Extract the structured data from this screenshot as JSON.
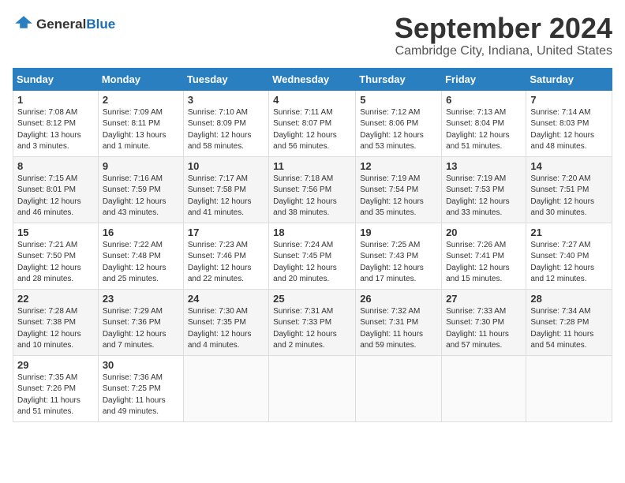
{
  "logo": {
    "general": "General",
    "blue": "Blue"
  },
  "title": "September 2024",
  "location": "Cambridge City, Indiana, United States",
  "days_of_week": [
    "Sunday",
    "Monday",
    "Tuesday",
    "Wednesday",
    "Thursday",
    "Friday",
    "Saturday"
  ],
  "weeks": [
    [
      {
        "day": "1",
        "info": "Sunrise: 7:08 AM\nSunset: 8:12 PM\nDaylight: 13 hours\nand 3 minutes."
      },
      {
        "day": "2",
        "info": "Sunrise: 7:09 AM\nSunset: 8:11 PM\nDaylight: 13 hours\nand 1 minute."
      },
      {
        "day": "3",
        "info": "Sunrise: 7:10 AM\nSunset: 8:09 PM\nDaylight: 12 hours\nand 58 minutes."
      },
      {
        "day": "4",
        "info": "Sunrise: 7:11 AM\nSunset: 8:07 PM\nDaylight: 12 hours\nand 56 minutes."
      },
      {
        "day": "5",
        "info": "Sunrise: 7:12 AM\nSunset: 8:06 PM\nDaylight: 12 hours\nand 53 minutes."
      },
      {
        "day": "6",
        "info": "Sunrise: 7:13 AM\nSunset: 8:04 PM\nDaylight: 12 hours\nand 51 minutes."
      },
      {
        "day": "7",
        "info": "Sunrise: 7:14 AM\nSunset: 8:03 PM\nDaylight: 12 hours\nand 48 minutes."
      }
    ],
    [
      {
        "day": "8",
        "info": "Sunrise: 7:15 AM\nSunset: 8:01 PM\nDaylight: 12 hours\nand 46 minutes."
      },
      {
        "day": "9",
        "info": "Sunrise: 7:16 AM\nSunset: 7:59 PM\nDaylight: 12 hours\nand 43 minutes."
      },
      {
        "day": "10",
        "info": "Sunrise: 7:17 AM\nSunset: 7:58 PM\nDaylight: 12 hours\nand 41 minutes."
      },
      {
        "day": "11",
        "info": "Sunrise: 7:18 AM\nSunset: 7:56 PM\nDaylight: 12 hours\nand 38 minutes."
      },
      {
        "day": "12",
        "info": "Sunrise: 7:19 AM\nSunset: 7:54 PM\nDaylight: 12 hours\nand 35 minutes."
      },
      {
        "day": "13",
        "info": "Sunrise: 7:19 AM\nSunset: 7:53 PM\nDaylight: 12 hours\nand 33 minutes."
      },
      {
        "day": "14",
        "info": "Sunrise: 7:20 AM\nSunset: 7:51 PM\nDaylight: 12 hours\nand 30 minutes."
      }
    ],
    [
      {
        "day": "15",
        "info": "Sunrise: 7:21 AM\nSunset: 7:50 PM\nDaylight: 12 hours\nand 28 minutes."
      },
      {
        "day": "16",
        "info": "Sunrise: 7:22 AM\nSunset: 7:48 PM\nDaylight: 12 hours\nand 25 minutes."
      },
      {
        "day": "17",
        "info": "Sunrise: 7:23 AM\nSunset: 7:46 PM\nDaylight: 12 hours\nand 22 minutes."
      },
      {
        "day": "18",
        "info": "Sunrise: 7:24 AM\nSunset: 7:45 PM\nDaylight: 12 hours\nand 20 minutes."
      },
      {
        "day": "19",
        "info": "Sunrise: 7:25 AM\nSunset: 7:43 PM\nDaylight: 12 hours\nand 17 minutes."
      },
      {
        "day": "20",
        "info": "Sunrise: 7:26 AM\nSunset: 7:41 PM\nDaylight: 12 hours\nand 15 minutes."
      },
      {
        "day": "21",
        "info": "Sunrise: 7:27 AM\nSunset: 7:40 PM\nDaylight: 12 hours\nand 12 minutes."
      }
    ],
    [
      {
        "day": "22",
        "info": "Sunrise: 7:28 AM\nSunset: 7:38 PM\nDaylight: 12 hours\nand 10 minutes."
      },
      {
        "day": "23",
        "info": "Sunrise: 7:29 AM\nSunset: 7:36 PM\nDaylight: 12 hours\nand 7 minutes."
      },
      {
        "day": "24",
        "info": "Sunrise: 7:30 AM\nSunset: 7:35 PM\nDaylight: 12 hours\nand 4 minutes."
      },
      {
        "day": "25",
        "info": "Sunrise: 7:31 AM\nSunset: 7:33 PM\nDaylight: 12 hours\nand 2 minutes."
      },
      {
        "day": "26",
        "info": "Sunrise: 7:32 AM\nSunset: 7:31 PM\nDaylight: 11 hours\nand 59 minutes."
      },
      {
        "day": "27",
        "info": "Sunrise: 7:33 AM\nSunset: 7:30 PM\nDaylight: 11 hours\nand 57 minutes."
      },
      {
        "day": "28",
        "info": "Sunrise: 7:34 AM\nSunset: 7:28 PM\nDaylight: 11 hours\nand 54 minutes."
      }
    ],
    [
      {
        "day": "29",
        "info": "Sunrise: 7:35 AM\nSunset: 7:26 PM\nDaylight: 11 hours\nand 51 minutes."
      },
      {
        "day": "30",
        "info": "Sunrise: 7:36 AM\nSunset: 7:25 PM\nDaylight: 11 hours\nand 49 minutes."
      },
      null,
      null,
      null,
      null,
      null
    ]
  ]
}
